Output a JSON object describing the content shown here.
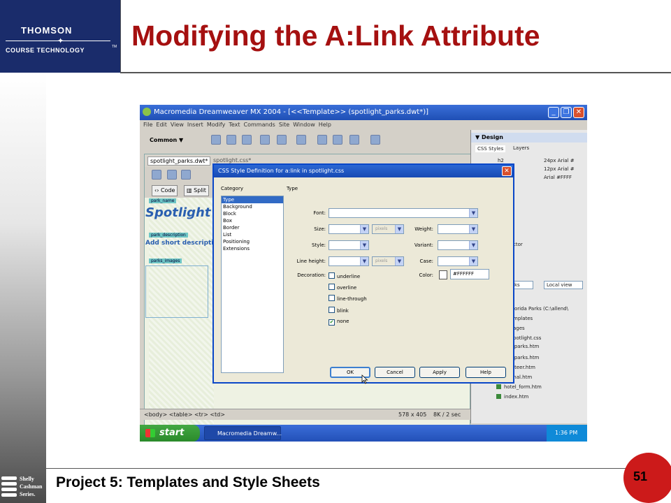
{
  "slide": {
    "title": "Modifying the A:Link Attribute",
    "footer": "Project 5: Templates and Style Sheets",
    "page_number": "51",
    "logo_line1": "THOMSON",
    "logo_line2": "COURSE TECHNOLOGY",
    "logo_tm": "TM",
    "series_line1": "Shelly",
    "series_line2": "Cashman",
    "series_line3": "Series."
  },
  "app": {
    "window_title": "Macromedia Dreamweaver MX 2004 - [<<Template>> (spotlight_parks.dwt*)]",
    "menus": [
      "File",
      "Edit",
      "View",
      "Insert",
      "Modify",
      "Text",
      "Commands",
      "Site",
      "Window",
      "Help"
    ],
    "insert_category": "Common",
    "doc_tabs": [
      "spotlight_parks.dwt*",
      "spotlight.css*"
    ],
    "view_buttons": [
      "Code",
      "Split"
    ],
    "region_labels": [
      "park_name",
      "park_description",
      "parks_images"
    ],
    "spotlight_text": "Spotlight",
    "short_desc_text": "Add short descriptio",
    "status": {
      "tags": "<body> <table> <tr> <td>",
      "size": "578 x 405",
      "download": "8K / 2 sec"
    }
  },
  "right_panel": {
    "design_header": "Design",
    "tabs": [
      "CSS Styles",
      "Layers"
    ],
    "style_rows": [
      {
        "name": "h2",
        "value": "24px Arial #"
      },
      {
        "name": "",
        "value": "12px Arial #"
      },
      {
        "name": "",
        "value": "Arial #FFFF"
      }
    ],
    "inspector_label": "ctor",
    "view_dropdown": "ks",
    "local_view": "Local view",
    "site_root": "lorida Parks (C:\\allend\\",
    "folders": [
      "mplates",
      "ages",
      "potlight.css"
    ],
    "files": [
      "ate_parks.htm",
      "ate_parks.htm",
      "olunteer.htm",
      "ational.htm",
      "hotel_form.htm",
      "index.htm"
    ]
  },
  "dialog": {
    "title": "CSS Style Definition for a:link in spotlight.css",
    "category_header": "Category",
    "type_header": "Type",
    "categories": [
      "Type",
      "Background",
      "Block",
      "Box",
      "Border",
      "List",
      "Positioning",
      "Extensions"
    ],
    "selected_category": "Type",
    "labels": {
      "font": "Font:",
      "size": "Size:",
      "style": "Style:",
      "line_height": "Line height:",
      "decoration": "Decoration:",
      "weight": "Weight:",
      "variant": "Variant:",
      "case": "Case:",
      "color": "Color:"
    },
    "unit_placeholder": "pixels",
    "decorations": [
      {
        "label": "underline",
        "checked": false
      },
      {
        "label": "overline",
        "checked": false
      },
      {
        "label": "line-through",
        "checked": false
      },
      {
        "label": "blink",
        "checked": false
      },
      {
        "label": "none",
        "checked": true
      }
    ],
    "color_value": "#FFFFFF",
    "buttons": [
      "OK",
      "Cancel",
      "Apply",
      "Help"
    ]
  },
  "taskbar": {
    "start_label": "start",
    "task_item": "Macromedia Dreamw...",
    "clock": "1:36 PM"
  }
}
